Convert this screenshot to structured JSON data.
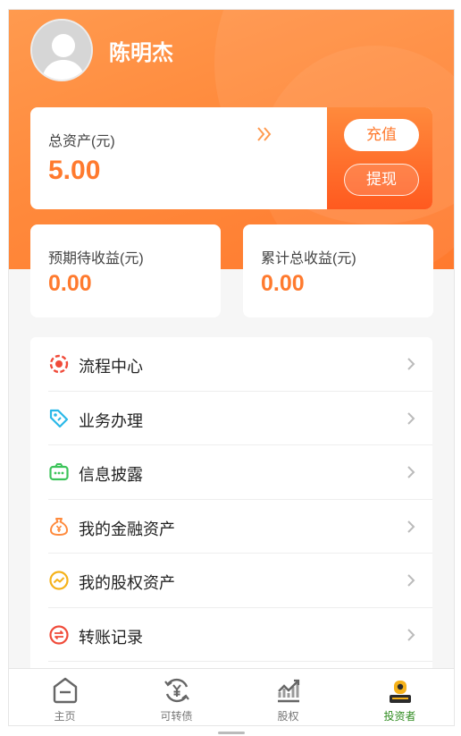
{
  "user": {
    "name": "陈明杰"
  },
  "assets": {
    "total_label": "总资产(元)",
    "total_value": "5.00",
    "recharge_label": "充值",
    "withdraw_label": "提现"
  },
  "stats": {
    "expected_label": "预期待收益(元)",
    "expected_value": "0.00",
    "cumulative_label": "累计总收益(元)",
    "cumulative_value": "0.00"
  },
  "menu": {
    "items": [
      {
        "label": "流程中心",
        "icon": "process-center-icon",
        "color": "#f04b3a"
      },
      {
        "label": "业务办理",
        "icon": "business-tag-icon",
        "color": "#2ab8e8"
      },
      {
        "label": "信息披露",
        "icon": "info-disclosure-icon",
        "color": "#3cc45a"
      },
      {
        "label": "我的金融资产",
        "icon": "money-bag-icon",
        "color": "#ff8a3c"
      },
      {
        "label": "我的股权资产",
        "icon": "equity-chart-icon",
        "color": "#f5b21a"
      },
      {
        "label": "转账记录",
        "icon": "transfer-record-icon",
        "color": "#f04b3a"
      }
    ]
  },
  "tabbar": {
    "tabs": [
      {
        "label": "主页",
        "icon": "home-icon"
      },
      {
        "label": "可转债",
        "icon": "convertible-bond-icon"
      },
      {
        "label": "股权",
        "icon": "equity-icon"
      },
      {
        "label": "投资者",
        "icon": "investor-icon",
        "active": true
      }
    ]
  },
  "colors": {
    "accent": "#ff7a2e",
    "active_tab": "#2e8b1e"
  }
}
